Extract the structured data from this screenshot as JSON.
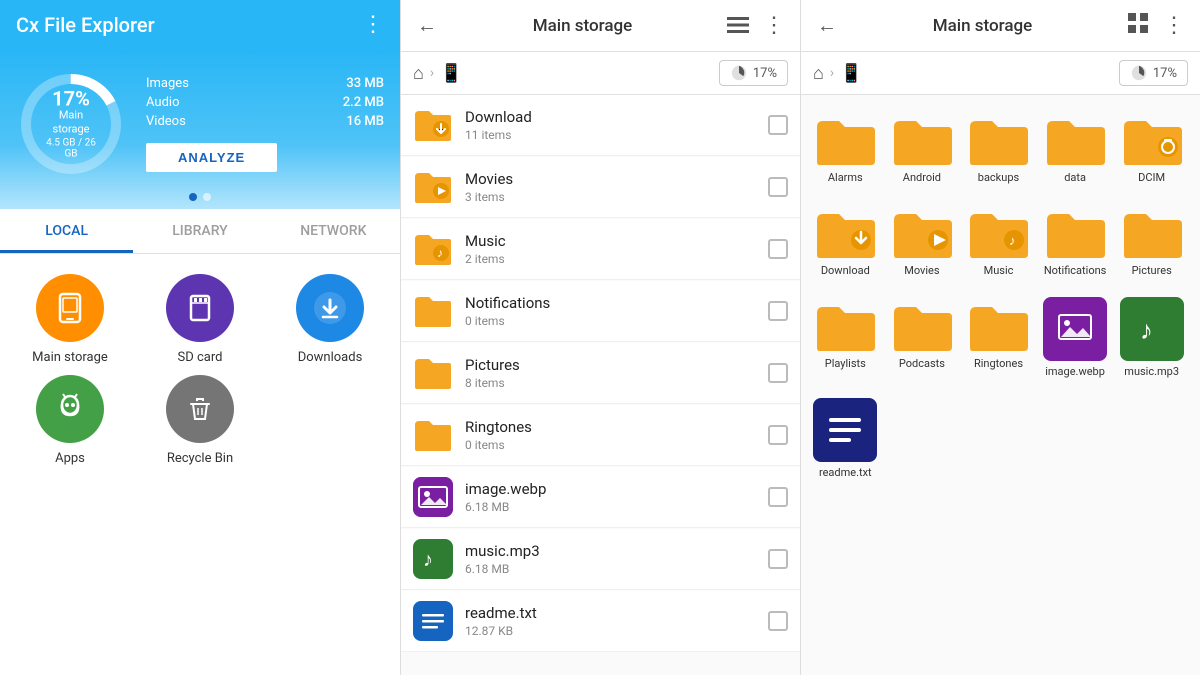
{
  "app": {
    "title": "Cx File Explorer"
  },
  "storage": {
    "percent": "17%",
    "label": "Main storage",
    "used": "4.5 GB",
    "total": "26 GB",
    "stats": [
      {
        "label": "Images",
        "value": "33 MB"
      },
      {
        "label": "Audio",
        "value": "2.2 MB"
      },
      {
        "label": "Videos",
        "value": "16 MB"
      }
    ],
    "analyze_btn": "ANALYZE"
  },
  "tabs": [
    {
      "id": "local",
      "label": "LOCAL",
      "active": true
    },
    {
      "id": "library",
      "label": "LIBRARY",
      "active": false
    },
    {
      "id": "network",
      "label": "NETWORK",
      "active": false
    }
  ],
  "shortcuts": [
    {
      "id": "main-storage",
      "label": "Main storage",
      "color": "icon-orange",
      "icon": "📱"
    },
    {
      "id": "sd-card",
      "label": "SD card",
      "color": "icon-purple",
      "icon": "💾"
    },
    {
      "id": "downloads",
      "label": "Downloads",
      "color": "icon-blue",
      "icon": "⬇"
    },
    {
      "id": "apps",
      "label": "Apps",
      "color": "icon-green",
      "icon": "🤖"
    },
    {
      "id": "recycle-bin",
      "label": "Recycle Bin",
      "color": "icon-gray",
      "icon": "🗑"
    }
  ],
  "middle_panel": {
    "title": "Main storage",
    "breadcrumb": [
      "🏠",
      ">",
      "📱"
    ],
    "storage_pct": "17%",
    "files": [
      {
        "name": "Download",
        "meta": "11 items",
        "type": "folder",
        "color": "#f5a623",
        "special": "download"
      },
      {
        "name": "Movies",
        "meta": "3 items",
        "type": "folder",
        "color": "#f5a623",
        "special": "movies"
      },
      {
        "name": "Music",
        "meta": "2 items",
        "type": "folder",
        "color": "#f5a623",
        "special": "music"
      },
      {
        "name": "Notifications",
        "meta": "0 items",
        "type": "folder",
        "color": "#f5a623",
        "special": null
      },
      {
        "name": "Pictures",
        "meta": "8 items",
        "type": "folder",
        "color": "#f5a623",
        "special": null
      },
      {
        "name": "Ringtones",
        "meta": "0 items",
        "type": "folder",
        "color": "#f5a623",
        "special": null
      },
      {
        "name": "image.webp",
        "meta": "6.18 MB",
        "type": "image",
        "color": "#7b1fa2",
        "special": null
      },
      {
        "name": "music.mp3",
        "meta": "6.18 MB",
        "type": "audio",
        "color": "#2e7d32",
        "special": null
      },
      {
        "name": "readme.txt",
        "meta": "12.87 KB",
        "type": "text",
        "color": "#1565c0",
        "special": null
      }
    ]
  },
  "right_panel": {
    "title": "Main storage",
    "storage_pct": "17%",
    "grid_items": [
      {
        "name": "Alarms",
        "type": "folder",
        "color": "#f5a623"
      },
      {
        "name": "Android",
        "type": "folder",
        "color": "#f5a623"
      },
      {
        "name": "backups",
        "type": "folder",
        "color": "#f5a623"
      },
      {
        "name": "data",
        "type": "folder",
        "color": "#f5a623"
      },
      {
        "name": "DCIM",
        "type": "folder-camera",
        "color": "#f5a623"
      },
      {
        "name": "Download",
        "type": "folder-download",
        "color": "#f5a623"
      },
      {
        "name": "Movies",
        "type": "folder-movies",
        "color": "#f5a623"
      },
      {
        "name": "Music",
        "type": "folder-music",
        "color": "#f5a623"
      },
      {
        "name": "Notifications",
        "type": "folder",
        "color": "#f5a623"
      },
      {
        "name": "Pictures",
        "type": "folder",
        "color": "#f5a623"
      },
      {
        "name": "Playlists",
        "type": "folder",
        "color": "#f5a623"
      },
      {
        "name": "Podcasts",
        "type": "folder",
        "color": "#f5a623"
      },
      {
        "name": "Ringtones",
        "type": "folder",
        "color": "#f5a623"
      },
      {
        "name": "image.webp",
        "type": "image",
        "color": "#7b1fa2"
      },
      {
        "name": "music.mp3",
        "type": "audio",
        "color": "#2e7d32"
      },
      {
        "name": "readme.txt",
        "type": "text",
        "color": "#1565c0"
      }
    ]
  },
  "icons": {
    "back": "←",
    "more": "⋮",
    "list_view": "☰",
    "grid_view": "⊞",
    "home": "⌂",
    "device": "📱",
    "chevron_right": "›"
  }
}
